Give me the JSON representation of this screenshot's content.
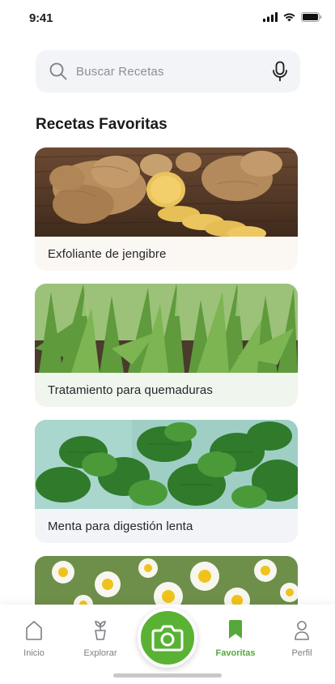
{
  "status_bar": {
    "time": "9:41",
    "icons": [
      "signal-icon",
      "wifi-icon",
      "battery-icon"
    ]
  },
  "search": {
    "placeholder": "Buscar Recetas",
    "icon": "search-icon",
    "mic_icon": "microphone-icon"
  },
  "section": {
    "title": "Recetas Favoritas"
  },
  "recipes": [
    {
      "label": "Exfoliante de jengibre",
      "image": "ginger-photo",
      "tint": "#fbf7f3"
    },
    {
      "label": "Tratamiento para quemaduras",
      "image": "aloe-vera-photo",
      "tint": "#f0f5ed"
    },
    {
      "label": "Menta para digestión lenta",
      "image": "mint-photo",
      "tint": "#f2f4f8"
    },
    {
      "label": "",
      "image": "chamomile-photo"
    }
  ],
  "tab_bar": {
    "items": [
      {
        "label": "Inicio",
        "icon": "home-icon",
        "active": false
      },
      {
        "label": "Explorar",
        "icon": "plant-pot-icon",
        "active": false
      },
      {
        "label": "Favoritas",
        "icon": "bookmark-icon",
        "active": true
      },
      {
        "label": "Perfil",
        "icon": "user-icon",
        "active": false
      }
    ],
    "center_action_icon": "camera-icon"
  },
  "colors": {
    "accent": "#59b234",
    "active_tab": "#57a83a",
    "inactive_tab": "#7d7f84",
    "search_bg": "#f2f4f8"
  }
}
